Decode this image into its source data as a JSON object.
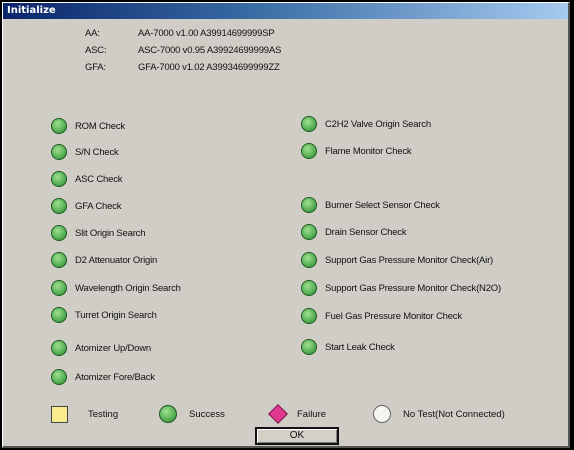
{
  "window": {
    "title": "Initialize"
  },
  "versions": [
    {
      "key": "AA:",
      "value": "AA-7000 v1.00 A39914699999SP"
    },
    {
      "key": "ASC:",
      "value": "ASC-7000 v0.95 A39924699999AS"
    },
    {
      "key": "GFA:",
      "value": "GFA-7000 v1.02 A39934699999ZZ"
    }
  ],
  "checks_left": [
    {
      "label": "ROM Check",
      "status": "success"
    },
    {
      "label": "S/N Check",
      "status": "success"
    },
    {
      "label": "ASC Check",
      "status": "success"
    },
    {
      "label": "GFA Check",
      "status": "success"
    },
    {
      "label": "Slit Origin Search",
      "status": "success"
    },
    {
      "label": "D2 Attenuator Origin",
      "status": "success"
    },
    {
      "label": "Wavelength Origin Search",
      "status": "success"
    },
    {
      "label": "Turret Origin Search",
      "status": "success"
    },
    {
      "label": "Atomizer Up/Down",
      "status": "success"
    },
    {
      "label": "Atomizer Fore/Back",
      "status": "success"
    }
  ],
  "checks_right": [
    {
      "label": "C2H2 Valve Origin Search",
      "status": "success"
    },
    {
      "label": "Flame Monitor Check",
      "status": "success"
    },
    {
      "label": "Burner Select Sensor Check",
      "status": "success"
    },
    {
      "label": "Drain Sensor Check",
      "status": "success"
    },
    {
      "label": "Support Gas Pressure Monitor Check(Air)",
      "status": "success"
    },
    {
      "label": "Support Gas Pressure Monitor Check(N2O)",
      "status": "success"
    },
    {
      "label": "Fuel Gas Pressure Monitor Check",
      "status": "success"
    },
    {
      "label": "Start Leak Check",
      "status": "success"
    }
  ],
  "legend": {
    "testing": "Testing",
    "success": "Success",
    "failure": "Failure",
    "no_test": "No Test(Not Connected)"
  },
  "colors": {
    "testing": "#f8ec8e",
    "success": "#4aa64a",
    "failure": "#e0398f",
    "no_test": "#f4f4f0"
  },
  "ok_label": "OK"
}
